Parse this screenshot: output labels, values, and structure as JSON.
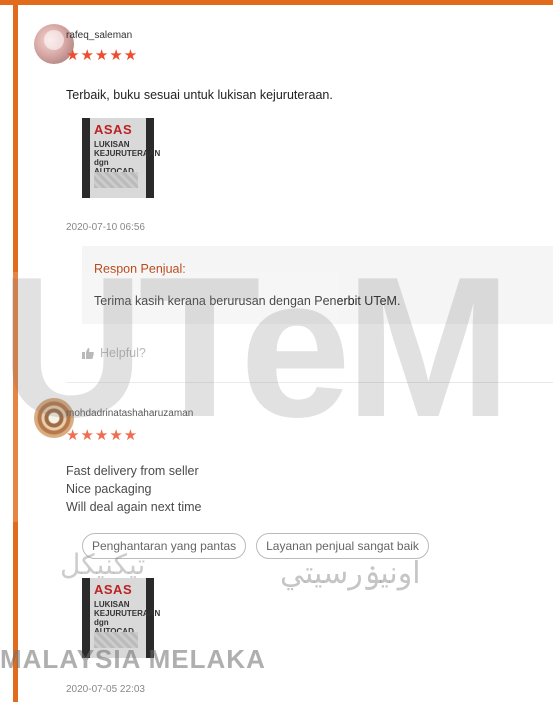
{
  "reviews": [
    {
      "username": "rafeq_saleman",
      "stars": "★★★★★",
      "rating": 5,
      "comment_lines": [
        "Terbaik, buku sesuai untuk lukisan kejuruteraan."
      ],
      "image": {
        "title": "ASAS",
        "subtitle": "LUKISAN KEJURUTERAAN dgn AUTOCAD"
      },
      "date": "2020-07-10 06:56",
      "seller_response": {
        "title": "Respon Penjual:",
        "text": "Terima kasih kerana berurusan dengan Penerbit UTeM."
      },
      "helpful_label": "Helpful?"
    },
    {
      "username": "mohdadrinatashaharuzaman",
      "stars": "★★★★★",
      "rating": 5,
      "comment_lines": [
        "Fast delivery from seller",
        "Nice packaging",
        "Will deal again next time"
      ],
      "tags": [
        "Penghantaran yang pantas",
        "Layanan penjual sangat baik"
      ],
      "image": {
        "title": "ASAS",
        "subtitle": "LUKISAN KEJURUTERAAN dgn AUTOCAD"
      },
      "date": "2020-07-05 22:03"
    }
  ],
  "watermark": {
    "logo_text": "UTeM",
    "arabic_text": "اونيۏرسيتي",
    "arabic_text_left": "تيكنيكل",
    "country_text": "MALAYSIA MELAKA"
  },
  "colors": {
    "accent": "#e26a1c",
    "stars": "#ee4d2d",
    "response_title": "#b94a1b"
  },
  "icons": {
    "helpful": "thumbs-up-icon"
  }
}
